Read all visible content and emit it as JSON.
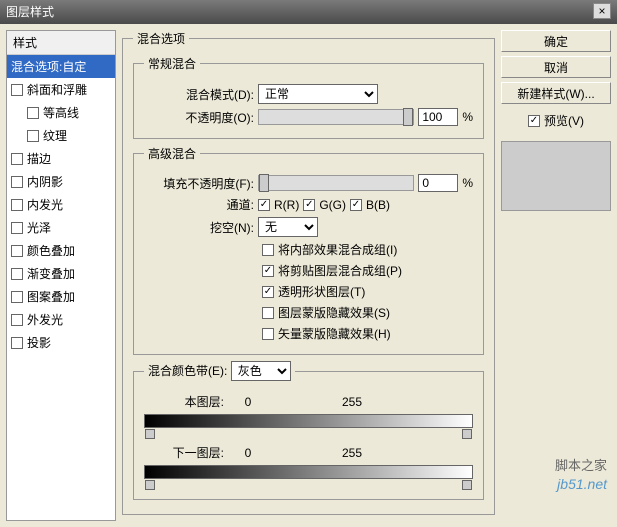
{
  "title": "图层样式",
  "styles_header": "样式",
  "styles_selected": "混合选项:自定",
  "styles_list": [
    {
      "label": "斜面和浮雕",
      "checked": false,
      "indent": false
    },
    {
      "label": "等高线",
      "checked": false,
      "indent": true
    },
    {
      "label": "纹理",
      "checked": false,
      "indent": true
    },
    {
      "label": "描边",
      "checked": false,
      "indent": false
    },
    {
      "label": "内阴影",
      "checked": false,
      "indent": false
    },
    {
      "label": "内发光",
      "checked": false,
      "indent": false
    },
    {
      "label": "光泽",
      "checked": false,
      "indent": false
    },
    {
      "label": "颜色叠加",
      "checked": false,
      "indent": false
    },
    {
      "label": "渐变叠加",
      "checked": false,
      "indent": false
    },
    {
      "label": "图案叠加",
      "checked": false,
      "indent": false
    },
    {
      "label": "外发光",
      "checked": false,
      "indent": false
    },
    {
      "label": "投影",
      "checked": false,
      "indent": false
    }
  ],
  "blend_options_title": "混合选项",
  "general": {
    "title": "常规混合",
    "mode_label": "混合模式(D):",
    "mode_value": "正常",
    "opacity_label": "不透明度(O):",
    "opacity_value": "100",
    "percent": "%"
  },
  "advanced": {
    "title": "高级混合",
    "fill_label": "填充不透明度(F):",
    "fill_value": "0",
    "percent": "%",
    "channel_label": "通道:",
    "r": "R(R)",
    "g": "G(G)",
    "b": "B(B)",
    "knockout_label": "挖空(N):",
    "knockout_value": "无",
    "opts": [
      {
        "label": "将内部效果混合成组(I)",
        "checked": false
      },
      {
        "label": "将剪贴图层混合成组(P)",
        "checked": true
      },
      {
        "label": "透明形状图层(T)",
        "checked": true
      },
      {
        "label": "图层蒙版隐藏效果(S)",
        "checked": false
      },
      {
        "label": "矢量蒙版隐藏效果(H)",
        "checked": false
      }
    ]
  },
  "blendif": {
    "title_label": "混合颜色带(E):",
    "value": "灰色",
    "this_label": "本图层:",
    "under_label": "下一图层:",
    "v0": "0",
    "v255": "255"
  },
  "buttons": {
    "ok": "确定",
    "cancel": "取消",
    "new_style": "新建样式(W)...",
    "preview": "预览(V)"
  },
  "watermark": "jb51.net",
  "watermark2": "脚本之家"
}
